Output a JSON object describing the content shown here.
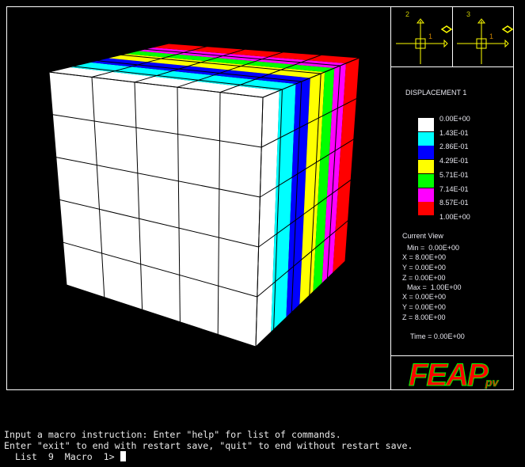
{
  "window": {
    "background": "#000000",
    "frame_color": "#ffffff"
  },
  "view_axes": [
    {
      "label_vertical": "2",
      "label_horizontal": "1",
      "color": "#ffff00"
    },
    {
      "label_vertical": "3",
      "label_horizontal": "1",
      "color": "#ffff00"
    }
  ],
  "legend": {
    "title": "DISPLACEMENT 1",
    "entries": [
      {
        "value": "0.00E+00",
        "color": "#ffffff"
      },
      {
        "value": "1.43E-01",
        "color": "#00ffff"
      },
      {
        "value": "2.86E-01",
        "color": "#0000ff"
      },
      {
        "value": "4.29E-01",
        "color": "#ffff00"
      },
      {
        "value": "5.71E-01",
        "color": "#00ff00"
      },
      {
        "value": "7.14E-01",
        "color": "#ff00ff"
      },
      {
        "value": "8.57E-01",
        "color": "#ff0000"
      },
      {
        "value": "1.00E+00",
        "color": "#ff0000"
      }
    ]
  },
  "current_view": {
    "heading": "Current View",
    "min_label": "Min =  0.00E+00",
    "min_x": "X = 8.00E+00",
    "min_y": "Y = 0.00E+00",
    "min_z": "Z = 0.00E+00",
    "max_label": "Max =  1.00E+00",
    "max_x": "X = 0.00E+00",
    "max_y": "Y = 0.00E+00",
    "max_z": "Z = 8.00E+00",
    "time": "Time = 0.00E+00"
  },
  "logo": {
    "text": "FEAP",
    "suffix": "pv",
    "color": "#ff0000",
    "outline": "#00ff00"
  },
  "mesh": {
    "elements_per_side": 5
  },
  "console": {
    "line1": "Input a macro instruction: Enter \"help\" for list of commands.",
    "line2": "Enter \"exit\" to end with restart save, \"quit\" to end without restart save.",
    "prompt": "  List  9  Macro  1> "
  }
}
